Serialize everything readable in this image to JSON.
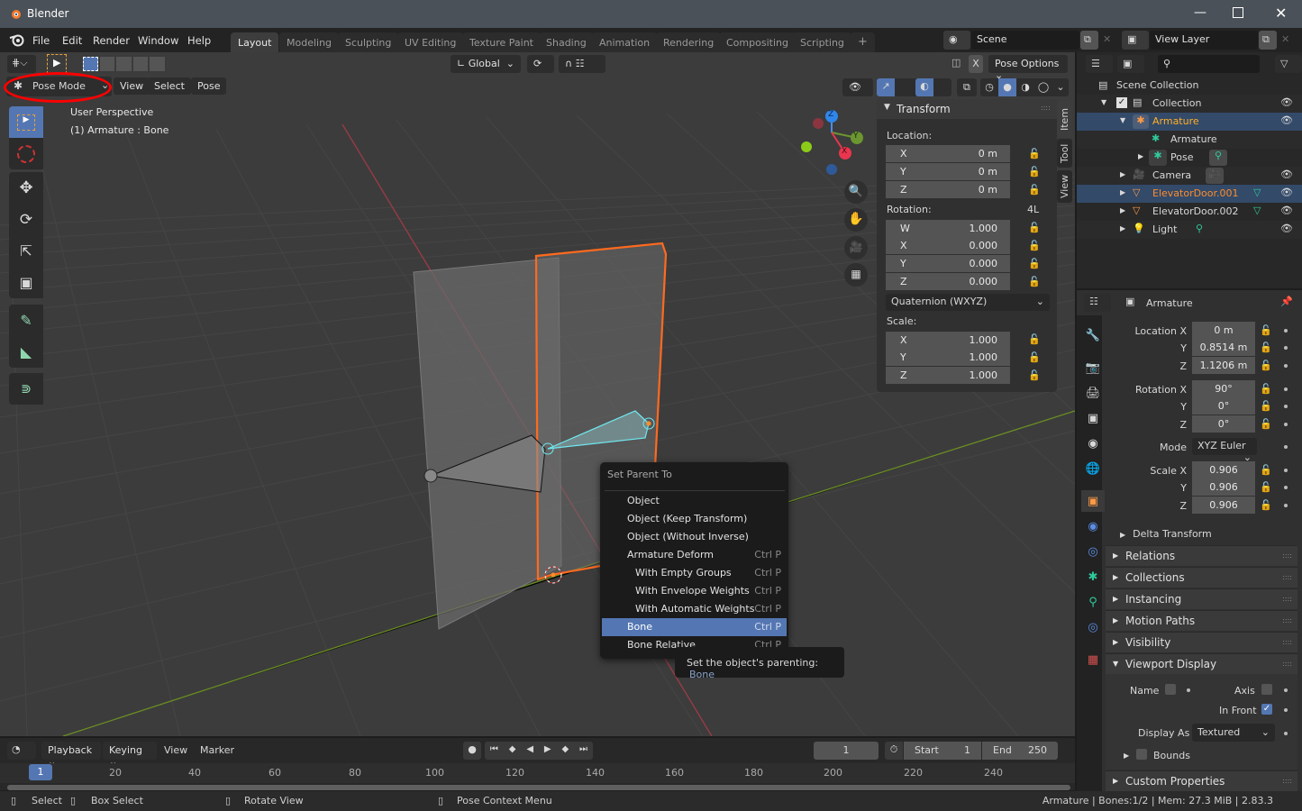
{
  "window": {
    "title": "Blender",
    "controls": [
      "minimize",
      "maximize",
      "close"
    ]
  },
  "menubar": {
    "items": [
      "File",
      "Edit",
      "Render",
      "Window",
      "Help"
    ]
  },
  "workspaces": {
    "tabs": [
      "Layout",
      "Modeling",
      "Sculpting",
      "UV Editing",
      "Texture Paint",
      "Shading",
      "Animation",
      "Rendering",
      "Compositing",
      "Scripting"
    ],
    "active": "Layout",
    "add_label": "+"
  },
  "scene": {
    "name": "Scene",
    "view_layer": "View Layer"
  },
  "tool_header": {
    "orientation": "Global",
    "pose_options": "Pose Options",
    "x_mirror": "X"
  },
  "viewport_header": {
    "mode": "Pose Mode",
    "menus": [
      "View",
      "Select",
      "Pose"
    ]
  },
  "viewport": {
    "view_name": "User Perspective",
    "object_info": "(1) Armature : Bone"
  },
  "gizmo": {
    "z": "Z",
    "y": "Y",
    "x": "X"
  },
  "npanel": {
    "tabs": [
      "Item",
      "Tool",
      "View"
    ],
    "section": "Transform",
    "location_label": "Location:",
    "location": [
      {
        "axis": "X",
        "value": "0 m"
      },
      {
        "axis": "Y",
        "value": "0 m"
      },
      {
        "axis": "Z",
        "value": "0 m"
      }
    ],
    "rotation_label": "Rotation:",
    "rotation_mode_short": "4L",
    "rotation": [
      {
        "axis": "W",
        "value": "1.000"
      },
      {
        "axis": "X",
        "value": "0.000"
      },
      {
        "axis": "Y",
        "value": "0.000"
      },
      {
        "axis": "Z",
        "value": "0.000"
      }
    ],
    "rotation_mode": "Quaternion (WXYZ)",
    "scale_label": "Scale:",
    "scale": [
      {
        "axis": "X",
        "value": "1.000"
      },
      {
        "axis": "Y",
        "value": "1.000"
      },
      {
        "axis": "Z",
        "value": "1.000"
      }
    ]
  },
  "context_menu": {
    "title": "Set Parent To",
    "items": [
      {
        "label": "Object",
        "shortcut": ""
      },
      {
        "label": "Object (Keep Transform)",
        "shortcut": ""
      },
      {
        "label": "Object (Without Inverse)",
        "shortcut": ""
      },
      {
        "label": "Armature Deform",
        "shortcut": "Ctrl P"
      },
      {
        "label": "With Empty Groups",
        "shortcut": "Ctrl P",
        "indent": true
      },
      {
        "label": "With Envelope Weights",
        "shortcut": "Ctrl P",
        "indent": true
      },
      {
        "label": "With Automatic Weights",
        "shortcut": "Ctrl P",
        "indent": true
      },
      {
        "label": "Bone",
        "shortcut": "Ctrl P",
        "highlighted": true
      },
      {
        "label": "Bone Relative",
        "shortcut": "Ctrl P"
      }
    ],
    "tooltip": {
      "text": "Set the object's parenting:",
      "value": "Bone"
    }
  },
  "outliner": {
    "root": "Scene Collection",
    "rows": [
      {
        "label": "Collection",
        "type": "collection"
      },
      {
        "label": "Armature",
        "type": "armature-object",
        "selected": true
      },
      {
        "label": "Armature",
        "type": "armature-data"
      },
      {
        "label": "Pose",
        "type": "pose"
      },
      {
        "label": "Camera",
        "type": "camera"
      },
      {
        "label": "ElevatorDoor.001",
        "type": "mesh",
        "selected": true
      },
      {
        "label": "ElevatorDoor.002",
        "type": "mesh"
      },
      {
        "label": "Light",
        "type": "light"
      }
    ]
  },
  "properties": {
    "object_name": "Armature",
    "location": {
      "label": "Location X",
      "x": "0 m",
      "y": "0.8514 m",
      "z": "1.1206 m"
    },
    "rotation": {
      "label": "Rotation X",
      "x": "90°",
      "y": "0°",
      "z": "0°"
    },
    "mode": {
      "label": "Mode",
      "value": "XYZ Euler"
    },
    "scale": {
      "label": "Scale X",
      "x": "0.906",
      "y": "0.906",
      "z": "0.906"
    },
    "axis_labels": {
      "y": "Y",
      "z": "Z"
    },
    "delta": "Delta Transform",
    "sections": [
      "Relations",
      "Collections",
      "Instancing",
      "Motion Paths",
      "Visibility",
      "Viewport Display"
    ],
    "viewport_display": {
      "name_label": "Name",
      "axis_label": "Axis",
      "in_front_label": "In Front",
      "in_front": true,
      "display_as_label": "Display As",
      "display_as": "Textured",
      "bounds_label": "Bounds"
    },
    "custom_props": "Custom Properties"
  },
  "timeline": {
    "menus": [
      "Playback",
      "Keying",
      "View",
      "Marker"
    ],
    "current_frame": "1",
    "start_label": "Start",
    "start": "1",
    "end_label": "End",
    "end": "250",
    "ruler": [
      "20",
      "40",
      "60",
      "80",
      "100",
      "120",
      "140",
      "160",
      "180",
      "200",
      "220",
      "240"
    ],
    "playhead": "1"
  },
  "statusbar": {
    "hints": [
      "Select",
      "Box Select",
      "Rotate View",
      "Pose Context Menu"
    ],
    "info": "Armature | Bones:1/2  | Mem: 27.3 MiB | 2.83.3"
  },
  "colors": {
    "accent": "#5477b3",
    "selected_orange": "#ff8c2b",
    "active_object": "#ffaf29",
    "highlight_red": "#ff0000"
  }
}
